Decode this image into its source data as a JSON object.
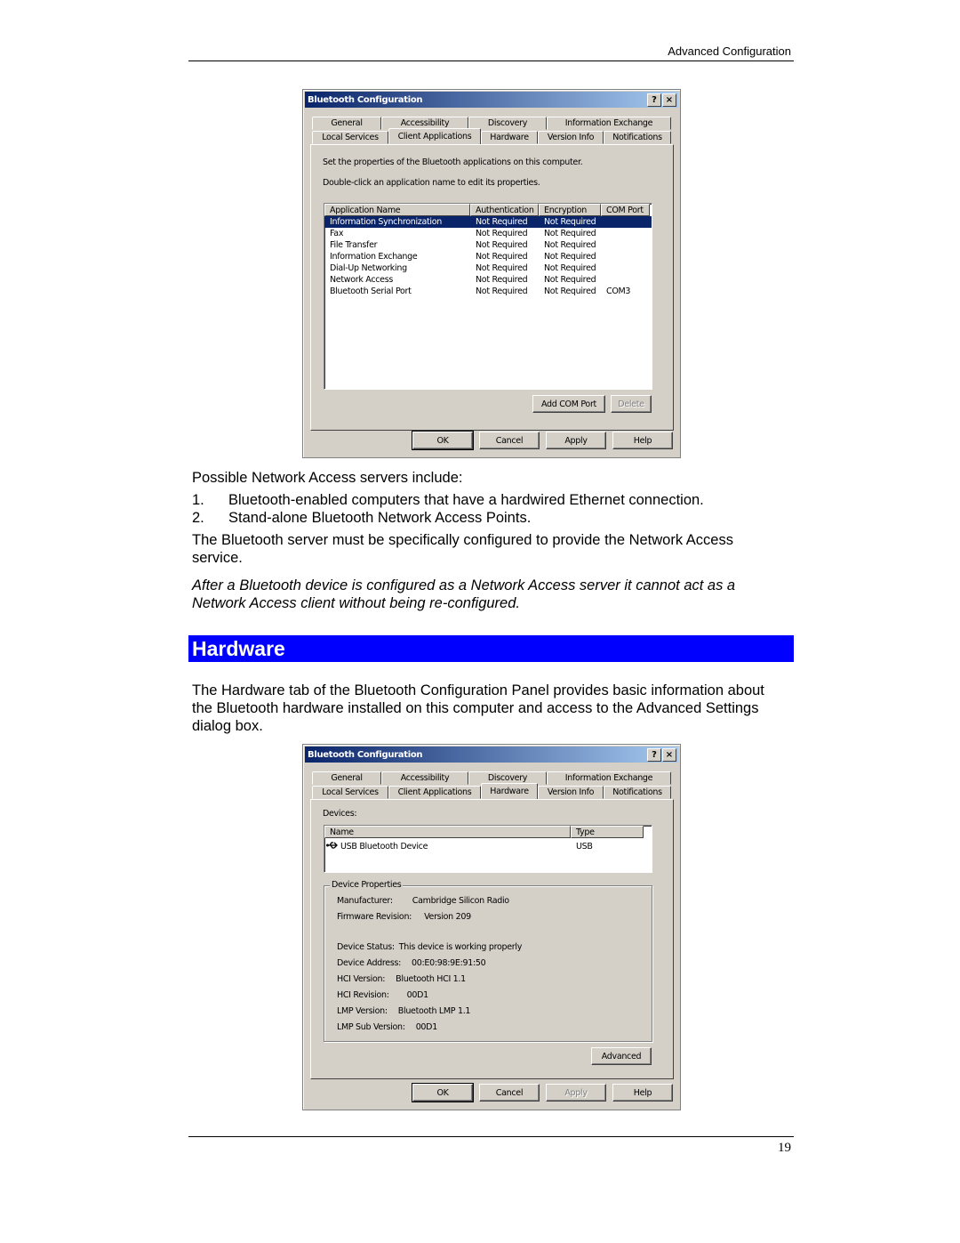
{
  "page": {
    "header": "Advanced Configuration",
    "page_number": "19"
  },
  "dialog1": {
    "title": "Bluetooth Configuration",
    "help_btn": "?",
    "close_btn": "×",
    "tabs_row1": [
      "General",
      "Accessibility",
      "Discovery",
      "Information Exchange"
    ],
    "tabs_row2": [
      "Local Services",
      "Client Applications",
      "Hardware",
      "Version Info",
      "Notifications"
    ],
    "active_tab": "Client Applications",
    "instruction1": "Set the properties of the Bluetooth applications on this computer.",
    "instruction2": "Double-click an application name to edit its properties.",
    "columns": [
      "Application Name",
      "Authentication",
      "Encryption",
      "COM Port"
    ],
    "rows": [
      {
        "name": "Information Synchronization",
        "auth": "Not Required",
        "enc": "Not Required",
        "com": "",
        "selected": true
      },
      {
        "name": "Fax",
        "auth": "Not Required",
        "enc": "Not Required",
        "com": ""
      },
      {
        "name": "File Transfer",
        "auth": "Not Required",
        "enc": "Not Required",
        "com": ""
      },
      {
        "name": "Information Exchange",
        "auth": "Not Required",
        "enc": "Not Required",
        "com": ""
      },
      {
        "name": "Dial-Up Networking",
        "auth": "Not Required",
        "enc": "Not Required",
        "com": ""
      },
      {
        "name": "Network Access",
        "auth": "Not Required",
        "enc": "Not Required",
        "com": ""
      },
      {
        "name": "Bluetooth Serial Port",
        "auth": "Not Required",
        "enc": "Not Required",
        "com": "COM3"
      }
    ],
    "add_com_port": "Add COM Port",
    "delete": "Delete",
    "ok": "OK",
    "cancel": "Cancel",
    "apply": "Apply",
    "help": "Help"
  },
  "text": {
    "intro": "Possible Network Access servers include:",
    "list": [
      {
        "num": "1.",
        "text": "Bluetooth-enabled computers that have a hardwired Ethernet connection."
      },
      {
        "num": "2.",
        "text": "Stand-alone Bluetooth Network Access Points."
      }
    ],
    "para1": "The Bluetooth server must be specifically configured to provide the Network Access service.",
    "note": "After a Bluetooth device is configured as a Network Access server it cannot act as a Network Access client without being re-configured.",
    "section_title": "Hardware",
    "para2": "The Hardware tab of the Bluetooth Configuration Panel provides basic information about the Bluetooth hardware installed on this computer and access to the Advanced Settings dialog box."
  },
  "dialog2": {
    "title": "Bluetooth Configuration",
    "help_btn": "?",
    "close_btn": "×",
    "tabs_row1": [
      "General",
      "Accessibility",
      "Discovery",
      "Information Exchange"
    ],
    "tabs_row2": [
      "Local Services",
      "Client Applications",
      "Hardware",
      "Version Info",
      "Notifications"
    ],
    "active_tab": "Hardware",
    "devices_label": "Devices:",
    "columns": [
      "Name",
      "Type"
    ],
    "devices": [
      {
        "name": "USB Bluetooth Device",
        "type": "USB",
        "icon": "usb-icon"
      }
    ],
    "group_label": "Device Properties",
    "properties": [
      {
        "label": "Manufacturer:",
        "value": "Cambridge Silicon Radio"
      },
      {
        "label": "Firmware Revision:",
        "value": "Version 209"
      },
      {
        "label": "Device Status:",
        "value": "This device is working properly"
      },
      {
        "label": "Device Address:",
        "value": "00:E0:98:9E:91:50"
      },
      {
        "label": "HCI Version:",
        "value": "Bluetooth HCI 1.1"
      },
      {
        "label": "HCI Revision:",
        "value": "00D1"
      },
      {
        "label": "LMP Version:",
        "value": "Bluetooth LMP 1.1"
      },
      {
        "label": "LMP Sub Version:",
        "value": "00D1"
      }
    ],
    "advanced": "Advanced",
    "ok": "OK",
    "cancel": "Cancel",
    "apply": "Apply",
    "help": "Help"
  }
}
